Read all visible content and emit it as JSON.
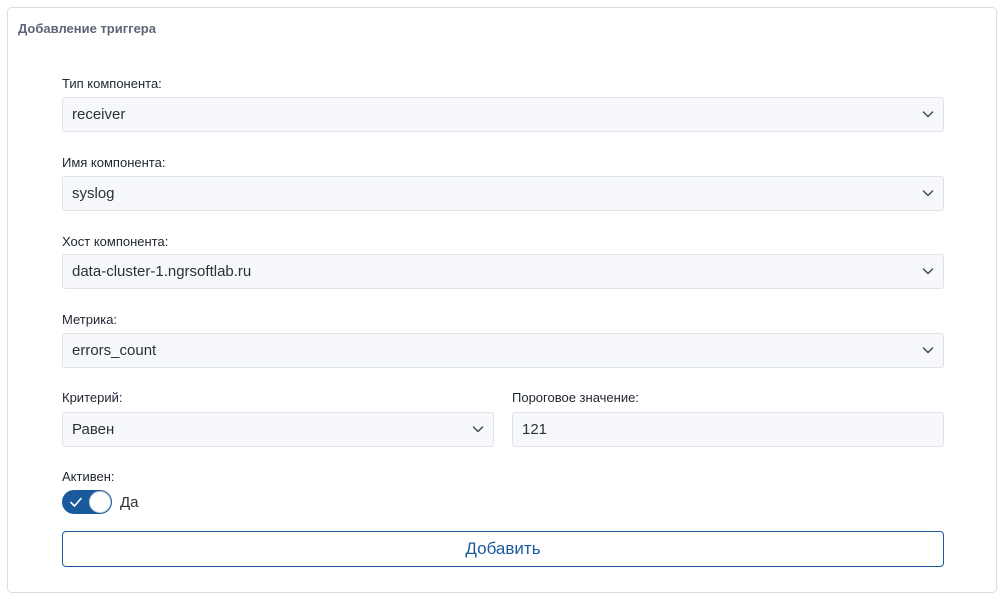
{
  "form": {
    "title": "Добавление триггера",
    "component_type": {
      "label": "Тип компонента:",
      "value": "receiver"
    },
    "component_name": {
      "label": "Имя компонента:",
      "value": "syslog"
    },
    "component_host": {
      "label": "Хост компонента:",
      "value": "data-cluster-1.ngrsoftlab.ru"
    },
    "metric": {
      "label": "Метрика:",
      "value": "errors_count"
    },
    "criterion": {
      "label": "Критерий:",
      "value": "Равен"
    },
    "threshold": {
      "label": "Пороговое значение:",
      "value": "121"
    },
    "active": {
      "label": "Активен:",
      "state_label": "Да",
      "checked": true
    },
    "submit_label": "Добавить"
  },
  "icons": {
    "dropdown": "chevron-down-icon",
    "toggle_check": "check-icon"
  },
  "colors": {
    "accent": "#1a5a9c",
    "field_background": "#f6f8fb",
    "field_border": "#dfe3e9",
    "title_text": "#5d6676"
  }
}
